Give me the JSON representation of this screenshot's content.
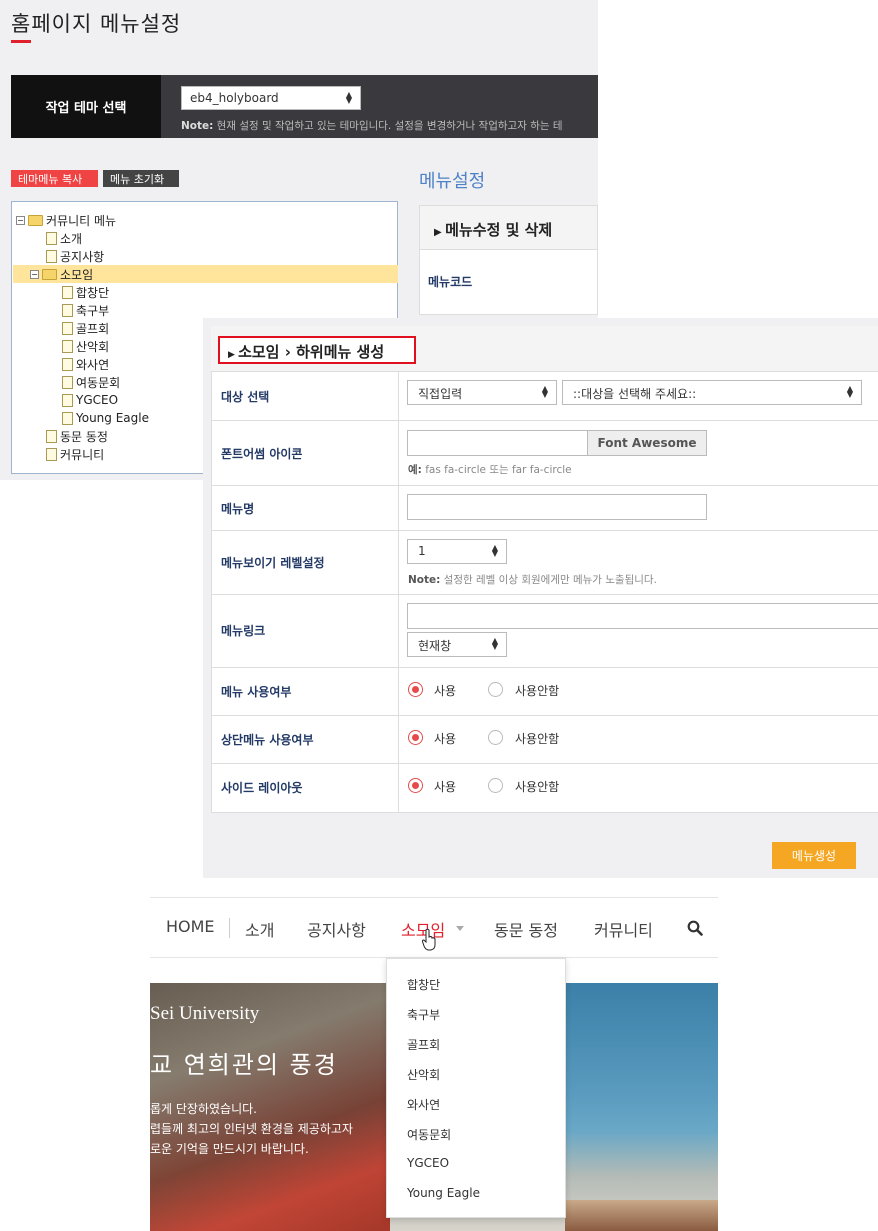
{
  "admin": {
    "page_title": "홈페이지 메뉴설정",
    "theme_label": "작업 테마 선택",
    "theme_value": "eb4_holyboard",
    "theme_note_label": "Note:",
    "theme_note_text": " 현재 설정 및 작업하고 있는 테마입니다. 설정을 변경하거나 작업하고자 하는 테",
    "copy_button": "테마메뉴 복사",
    "reset_button": "메뉴 초기화",
    "tree": {
      "root": "커뮤니티 메뉴",
      "items": [
        "소개",
        "공지사항",
        "소모임",
        "동문 동정",
        "커뮤니티"
      ],
      "sub_items": [
        "합창단",
        "축구부",
        "골프회",
        "산악회",
        "와사연",
        "여동문회",
        "YGCEO",
        "Young Eagle"
      ]
    },
    "menu_setting_title": "메뉴설정",
    "edit_header": "메뉴수정 및 삭제",
    "menucode_label": "메뉴코드"
  },
  "submenu": {
    "title_parent": "소모임",
    "title_action": "하위메뉴 생성",
    "target_label": "대상 선택",
    "target_mode": "직접입력",
    "target_placeholder": "::대상을 선택해 주세요::",
    "icon_label": "폰트어썸 아이콘",
    "fa_button": "Font Awesome",
    "icon_help_label": "예:",
    "icon_help_text": " fas fa-circle 또는 far fa-circle",
    "name_label": "메뉴명",
    "level_label": "메뉴보이기 레벨설정",
    "level_value": "1",
    "level_note_label": "Note:",
    "level_note_text": " 설정한 레벨 이상 회원에게만 메뉴가 노출됩니다.",
    "link_label": "메뉴링크",
    "link_target": "현재창",
    "use_label": "메뉴 사용여부",
    "top_use_label": "상단메뉴 사용여부",
    "side_layout_label": "사이드 레이아웃",
    "opt_use": "사용",
    "opt_nouse": "사용안함",
    "create_button": "메뉴생성",
    "accent_color": "#e64a4a",
    "button_color": "#f5a623"
  },
  "site": {
    "nav": [
      "HOME",
      "소개",
      "공지사항",
      "소모임",
      "동문 동정",
      "커뮤니티"
    ],
    "active_nav": "소모임",
    "dropdown": [
      "합창단",
      "축구부",
      "골프회",
      "산악회",
      "와사연",
      "여동문회",
      "YGCEO",
      "Young Eagle"
    ],
    "hero_kicker": "Sei University",
    "hero_title": "교 연희관의 풍경",
    "hero_lines": [
      "롭게 단장하였습니다.",
      "렵들께 최고의 인터넷 환경을 제공하고자",
      "로운 기억을 만드시기 바랍니다."
    ],
    "brand_color": "#e0202c"
  }
}
